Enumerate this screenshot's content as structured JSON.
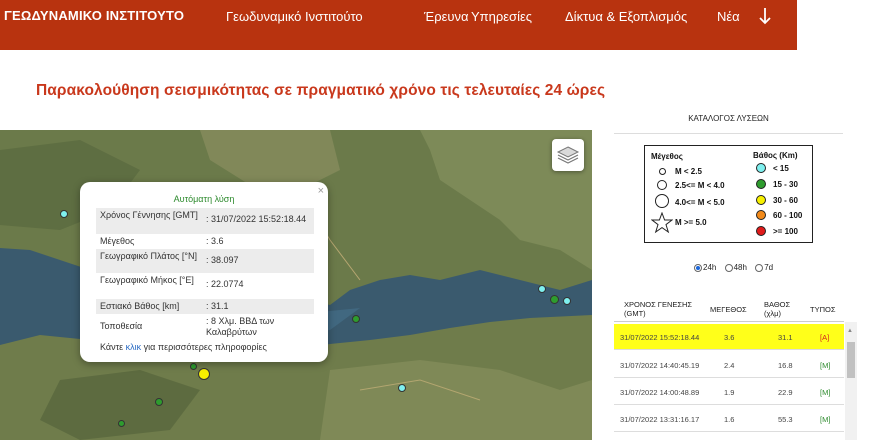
{
  "header": {
    "logo": "ΓΕΩΔΥΝΑΜΙΚΟ ΙΝΣΤΙΤΟΥΤΟ",
    "nav": [
      "Γεωδυναμικό Ινστιτούτο",
      "Έρευνα",
      "Υπηρεσίες",
      "Δίκτυα & Εξοπλισμός",
      "Νέα"
    ]
  },
  "headline": "Παρακολούθηση σεισμικότητας σε πραγματικό χρόνο τις τελευταίες 24 ώρες",
  "popup": {
    "title": "Αυτόματη λύση",
    "close": "×",
    "rows": [
      {
        "label": "Χρόνος Γέννησης [GMT]",
        "value": ": 31/07/2022 15:52:18.44"
      },
      {
        "label": "Μέγεθος",
        "value": ": 3.6"
      },
      {
        "label": "Γεωγραφικό Πλάτος [°N]",
        "value": ": 38.097"
      },
      {
        "label": "Γεωγραφικό Μήκος [°E]",
        "value": ": 22.0774"
      },
      {
        "label": "Εστιακό Βάθος [km]",
        "value": ": 31.1"
      },
      {
        "label": "Τοποθεσία",
        "value": ": 8 Χλμ. ΒΒΔ των Καλαβρύτων"
      }
    ],
    "more_prefix": "Κάντε ",
    "more_link": "κλικ",
    "more_suffix": " για περισσότερες πληροφορίες"
  },
  "catalog": {
    "title": "ΚΑΤΑΛΟΓΟΣ ΛΥΣΕΩΝ",
    "legend": {
      "magnitude_title": "Μέγεθος",
      "magnitude_items": [
        "M < 2.5",
        "2.5<= M < 4.0",
        "4.0<= M < 5.0",
        "M >= 5.0"
      ],
      "depth_title": "Βάθος (Km)",
      "depth_items": [
        "< 15",
        "15 - 30",
        "30 - 60",
        "60 - 100",
        ">= 100"
      ],
      "depth_colors": [
        "#7ff0ef",
        "#2e9c2e",
        "#f7f000",
        "#f28a1a",
        "#e01b1b"
      ]
    },
    "periods": [
      "24h",
      "48h",
      "7d"
    ],
    "selected_period": "24h",
    "columns": [
      "ΧΡΟΝΟΣ ΓΕΝΕΣΗΣ (GMT)",
      "ΜΕΓΕΘΟΣ",
      "ΒΑΘΟΣ (χλμ)",
      "ΤΥΠΟΣ"
    ],
    "events": [
      {
        "time": "31/07/2022 15:52:18.44",
        "mag": "3.6",
        "depth": "31.1",
        "type": "[A]"
      },
      {
        "time": "31/07/2022 14:40:45.19",
        "mag": "2.4",
        "depth": "16.8",
        "type": "[M]"
      },
      {
        "time": "31/07/2022 14:00:48.89",
        "mag": "1.9",
        "depth": "22.9",
        "type": "[M]"
      },
      {
        "time": "31/07/2022 13:31:16.17",
        "mag": "1.6",
        "depth": "55.3",
        "type": "[M]"
      }
    ]
  },
  "colors": {
    "header_bg": "#b8330f",
    "headline": "#c9381c",
    "highlight_row": "#ffff1a",
    "type_auto": "#d42020",
    "type_manual": "#2e8b2e"
  }
}
